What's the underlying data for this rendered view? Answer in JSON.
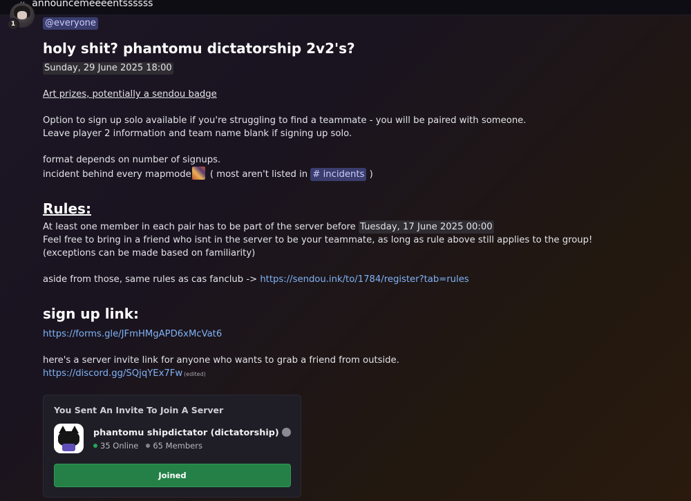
{
  "channel": {
    "hash": "#",
    "name": "announcemeeeentssssss"
  },
  "message": {
    "mention": "@everyone",
    "title": "holy shit? phantomu dictatorship 2v2's?",
    "event_time": "Sunday, 29 June 2025 18:00",
    "prizes": "Art prizes, potentially a sendou badge",
    "solo_line1": "Option to sign up solo available if you're struggling to find a teammate - you will be paired with someone.",
    "solo_line2": "Leave player 2 information and team name blank if signing up solo.",
    "format_line": "format depends on number of signups.",
    "incident_prefix": "incident behind every mapmode",
    "incident_mid": " ( most aren't listed in ",
    "incident_channel": "# incidents",
    "incident_suffix": " )",
    "rules_heading": "Rules:",
    "rule1_prefix": "At least one member in each pair has to be part of the server before",
    "rule1_time": "Tuesday, 17 June 2025 00:00",
    "rule2": "Feel free to bring in a friend who isnt in the server to be your teammate, as long as rule above still applies to the group!",
    "rule3": "(exceptions can be made based on familiarity)",
    "rules_aside_prefix": "aside from those, same rules as cas fanclub  -> ",
    "rules_link": "https://sendou.ink/to/1784/register?tab=rules",
    "signup_heading": "sign up link:",
    "signup_link": "https://forms.gle/JFmHMgAPD6xMcVat6",
    "invite_text": "here's a server invite link for anyone who wants to grab a friend from outside.",
    "invite_link": "https://discord.gg/SQjqYEx7Fw",
    "edited": "(edited)"
  },
  "invite_card": {
    "header": "You Sent An Invite To Join A Server",
    "server_name": "phantomu shipdictator (dictatorship)",
    "online": "35 Online",
    "members": "65 Members",
    "button": "Joined",
    "online_color": "#23a559",
    "members_color": "#80848e"
  }
}
